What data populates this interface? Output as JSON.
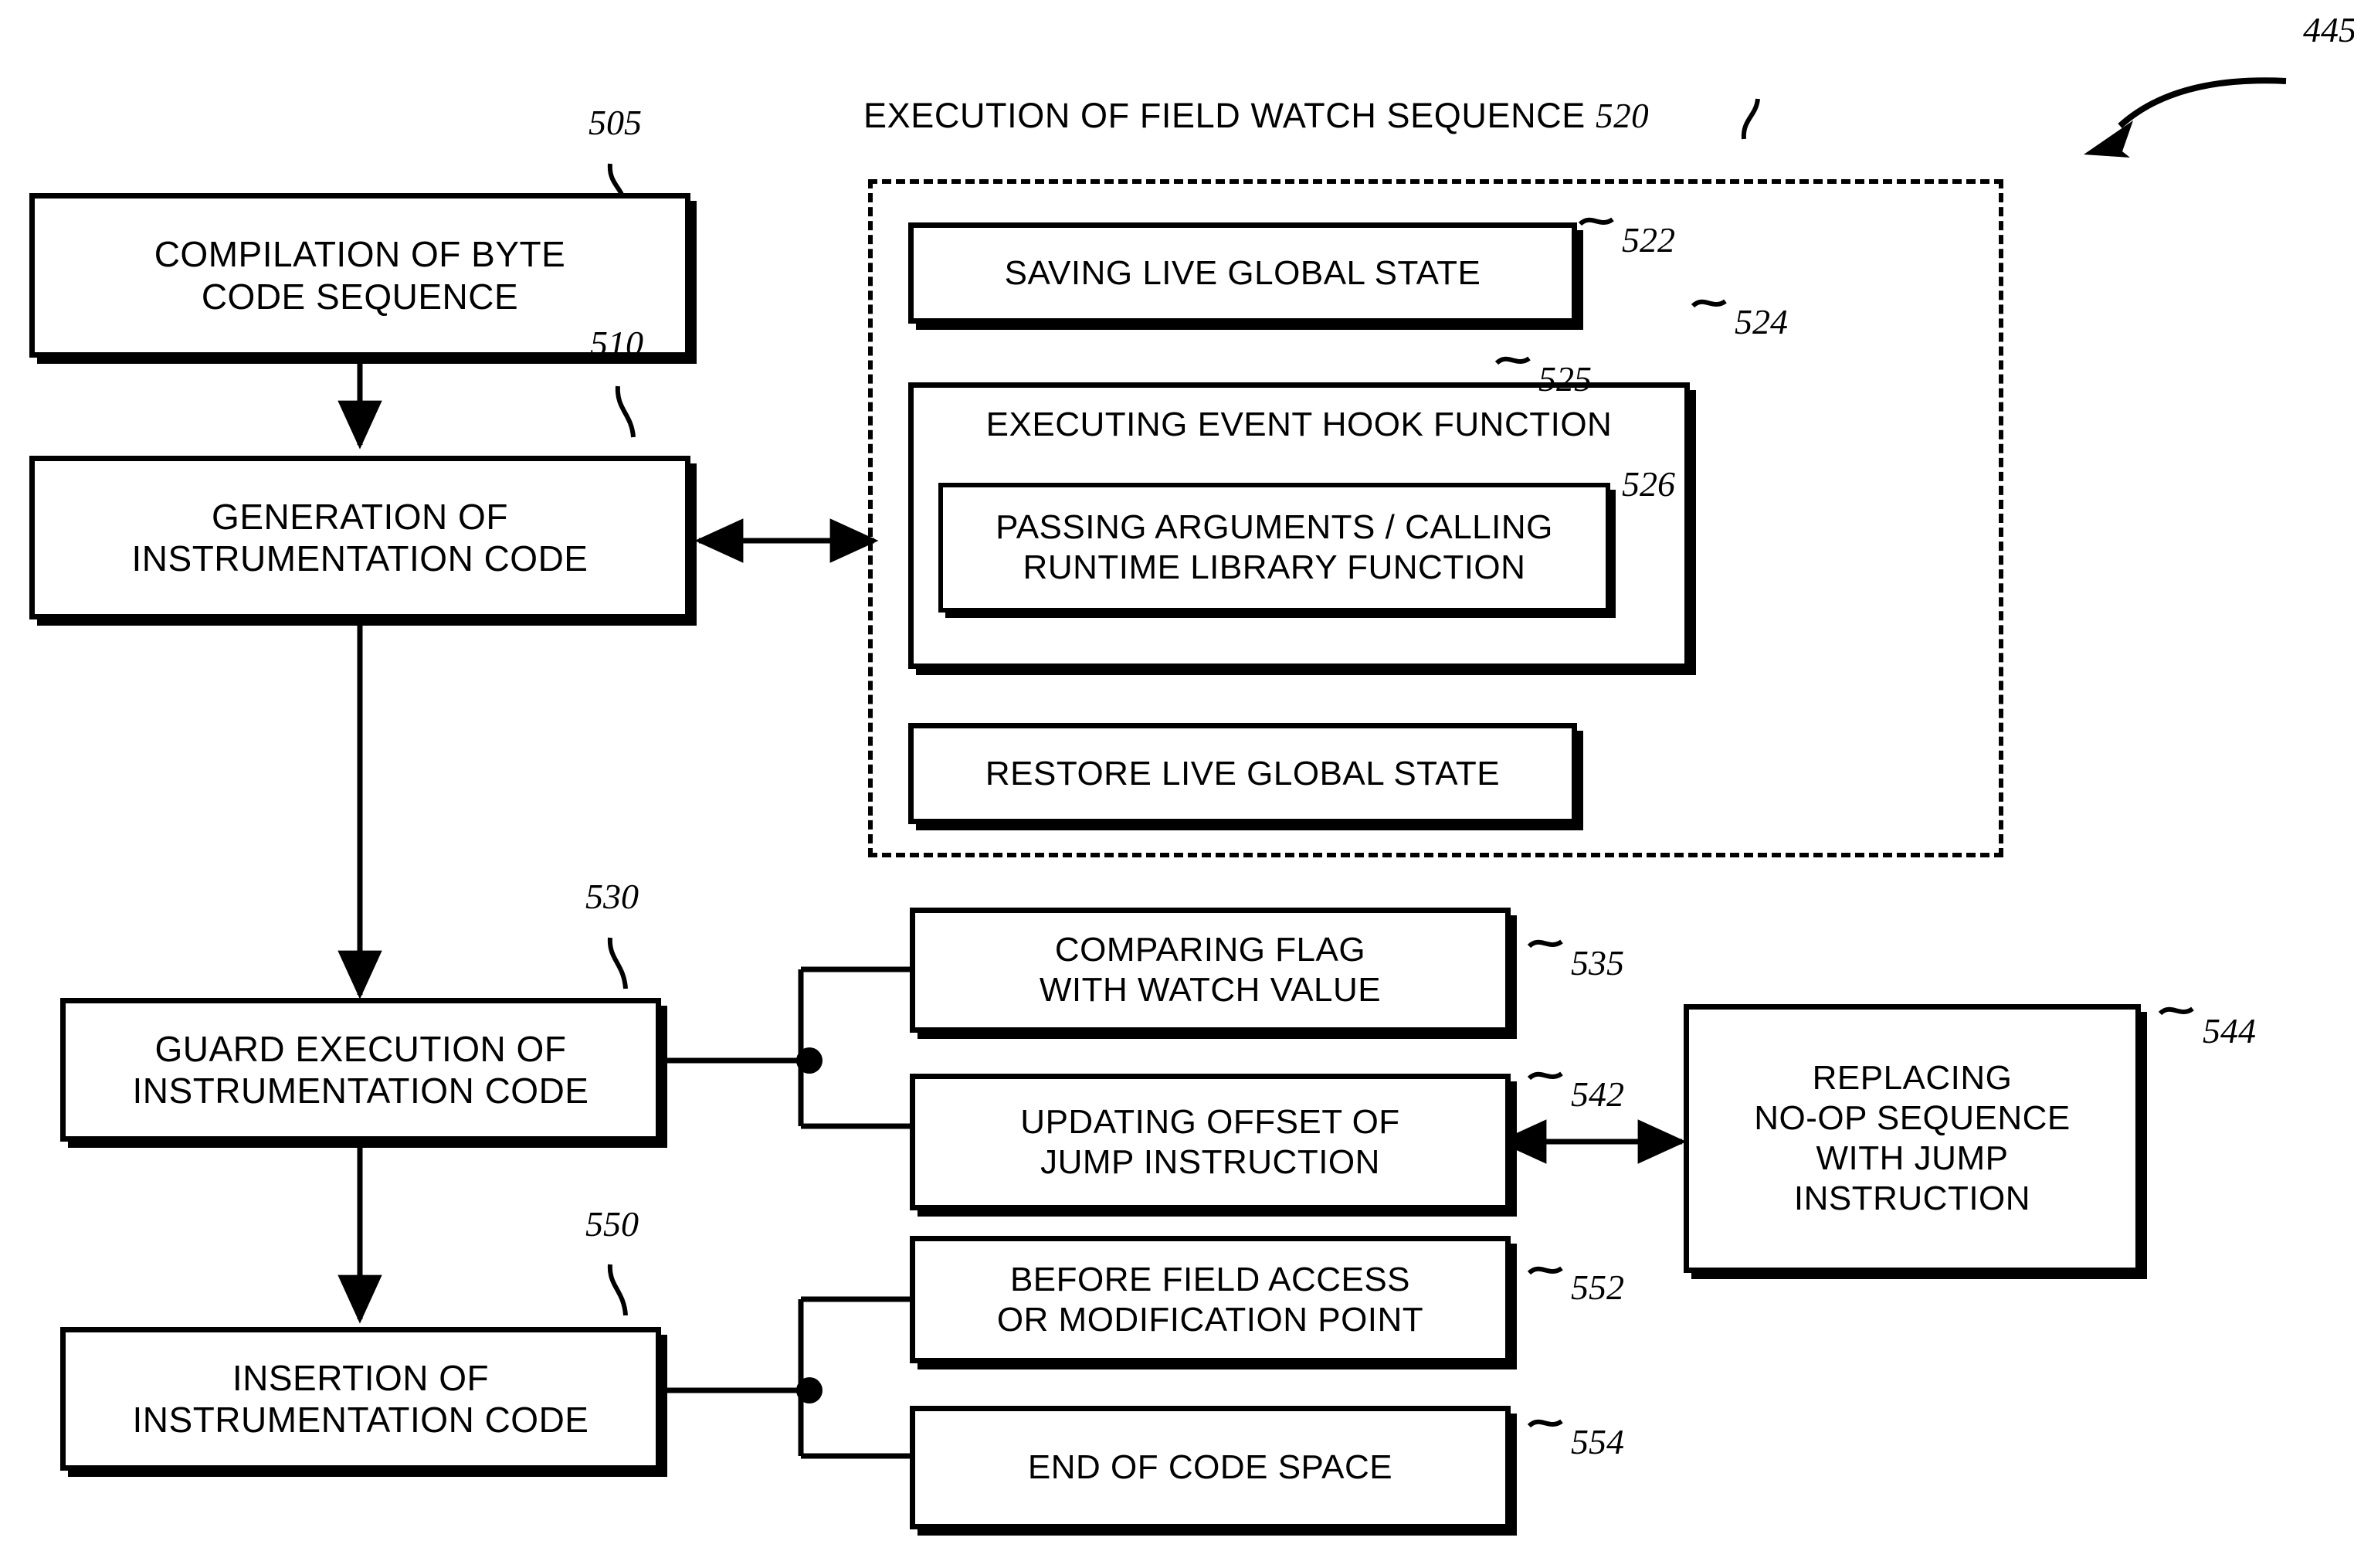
{
  "figure": {
    "figure_ref": "445",
    "group_title_text": "EXECUTION OF FIELD WATCH SEQUENCE ",
    "group_title_ref": "520"
  },
  "refs": {
    "r445": "445",
    "r505": "505",
    "r510": "510",
    "r520": "520",
    "r522": "522",
    "r524": "524",
    "r525": "525",
    "r526": "526",
    "r530": "530",
    "r535": "535",
    "r542": "542",
    "r544": "544",
    "r550": "550",
    "r552": "552",
    "r554": "554"
  },
  "boxes": {
    "b505": {
      "label": "COMPILATION OF BYTE\nCODE SEQUENCE",
      "ref": "505"
    },
    "b510": {
      "label": "GENERATION OF\nINSTRUMENTATION CODE",
      "ref": "510"
    },
    "b522": {
      "label": "SAVING LIVE GLOBAL STATE",
      "ref": "522"
    },
    "b524": {
      "label": "EXECUTING EVENT HOOK FUNCTION",
      "ref": "524"
    },
    "b525": {
      "label": "PASSING ARGUMENTS / CALLING\nRUNTIME LIBRARY FUNCTION",
      "ref": "525"
    },
    "b526": {
      "label": "RESTORE LIVE GLOBAL STATE",
      "ref": "526"
    },
    "b530": {
      "label": "GUARD EXECUTION OF\nINSTRUMENTATION CODE",
      "ref": "530"
    },
    "b535": {
      "label": "COMPARING FLAG\nWITH WATCH VALUE",
      "ref": "535"
    },
    "b542": {
      "label": "UPDATING OFFSET OF\nJUMP INSTRUCTION",
      "ref": "542"
    },
    "b544": {
      "label": "REPLACING\nNO-OP SEQUENCE\nWITH JUMP\nINSTRUCTION",
      "ref": "544"
    },
    "b550": {
      "label": "INSERTION OF\nINSTRUMENTATION CODE",
      "ref": "550"
    },
    "b552": {
      "label": "BEFORE FIELD ACCESS\nOR MODIFICATION POINT",
      "ref": "552"
    },
    "b554": {
      "label": "END OF CODE SPACE",
      "ref": "554"
    }
  },
  "colors": {
    "ink": "#000000",
    "paper": "#ffffff"
  }
}
